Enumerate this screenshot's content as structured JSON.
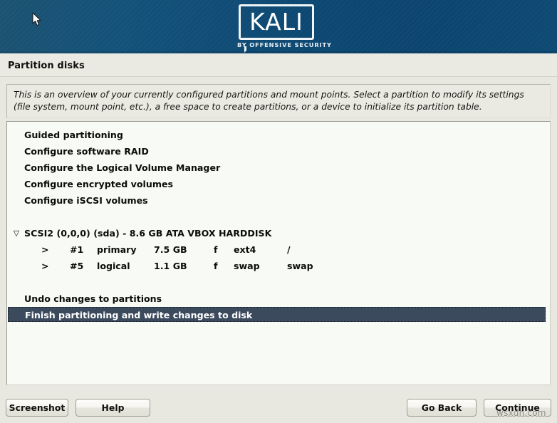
{
  "banner": {
    "logo_word": "KALI",
    "logo_tagline": "BY OFFENSIVE SECURITY",
    "background_color": "#0d4872"
  },
  "header": {
    "page_title": "Partition disks"
  },
  "description": {
    "text": "This is an overview of your currently configured partitions and mount points. Select a partition to modify its settings (file system, mount point, etc.), a free space to create partitions, or a device to initialize its partition table."
  },
  "list": {
    "menu_items": [
      {
        "label": "Guided partitioning"
      },
      {
        "label": "Configure software RAID"
      },
      {
        "label": "Configure the Logical Volume Manager"
      },
      {
        "label": "Configure encrypted volumes"
      },
      {
        "label": "Configure iSCSI volumes"
      }
    ],
    "disk": {
      "expander": "▽",
      "label": "SCSI2 (0,0,0) (sda) - 8.6 GB ATA VBOX HARDDISK",
      "partitions": [
        {
          "arrow": ">",
          "number": "#1",
          "type": "primary",
          "size": "7.5 GB",
          "flag": "f",
          "filesystem": "ext4",
          "mountpoint": "/"
        },
        {
          "arrow": ">",
          "number": "#5",
          "type": "logical",
          "size": "1.1 GB",
          "flag": "f",
          "filesystem": "swap",
          "mountpoint": "swap"
        }
      ]
    },
    "actions": [
      {
        "label": "Undo changes to partitions",
        "selected": false
      },
      {
        "label": "Finish partitioning and write changes to disk",
        "selected": true
      }
    ],
    "selection_color": "#3c4a5e"
  },
  "buttons": {
    "screenshot": "Screenshot",
    "help": "Help",
    "go_back": "Go Back",
    "continue": "Continue"
  },
  "watermark": {
    "text": "wsxdn.com"
  }
}
